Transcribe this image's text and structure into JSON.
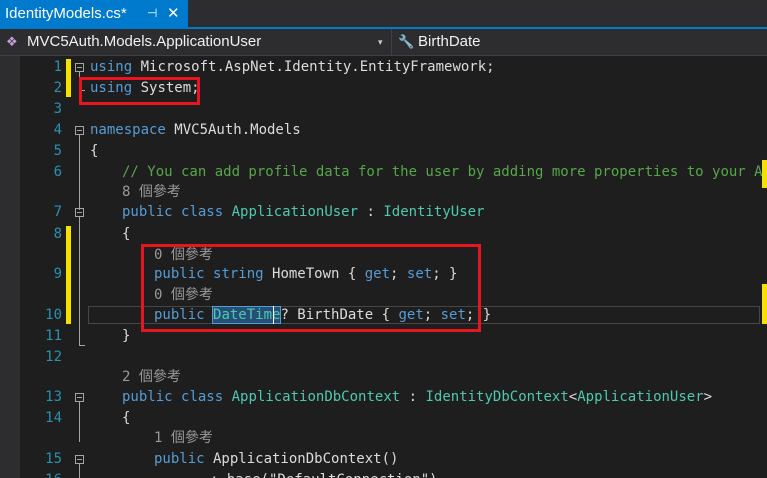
{
  "tab": {
    "title": "IdentityModels.cs*",
    "pin_glyph": "⊣",
    "close_glyph": "✕"
  },
  "nav": {
    "class_selector": "MVC5Auth.Models.ApplicationUser",
    "member_selector": "BirthDate",
    "dropdown_glyph": "▾"
  },
  "code": {
    "l1": {
      "kw": "using",
      "rest": " Microsoft.AspNet.Identity.EntityFramework;"
    },
    "l2": {
      "kw": "using",
      "rest": " System;"
    },
    "l4": {
      "kw": "namespace",
      "rest": " MVC5Auth.Models"
    },
    "l5": "{",
    "l6": "// You can add profile data for the user by adding more properties to your Appli",
    "lens_8": "8 個參考",
    "l7": {
      "kw1": "public",
      "kw2": "class",
      "type1": "ApplicationUser",
      "sep": " : ",
      "type2": "IdentityUser"
    },
    "l8": "{",
    "lens_0a": "0 個參考",
    "l9": {
      "kw1": "public",
      "kw2": "string",
      "rest1": " HomeTown { ",
      "get": "get",
      "semi1": "; ",
      "set": "set",
      "rest2": "; }"
    },
    "lens_0b": "0 個參考",
    "l10": {
      "kw1": "public",
      "type": "DateTime",
      "rest1": "? BirthDate { ",
      "get": "get",
      "semi1": "; ",
      "set": "set",
      "rest2": "; }"
    },
    "l11": "}",
    "lens_2": "2 個參考",
    "l13": {
      "kw1": "public",
      "kw2": "class",
      "type1": "ApplicationDbContext",
      "sep": " : ",
      "type2": "IdentityDbContext",
      "lt": "<",
      "type3": "ApplicationUser",
      "gt": ">"
    },
    "l14": "{",
    "lens_1": "1 個參考",
    "l15": {
      "kw1": "public",
      "rest": " ApplicationDbContext()"
    },
    "l16_partial": ": base(\"DefaultConnection\")"
  },
  "line_numbers": [
    "1",
    "2",
    "3",
    "4",
    "5",
    "6",
    "7",
    "8",
    "9",
    "10",
    "11",
    "12",
    "13",
    "14",
    "15",
    "16"
  ]
}
